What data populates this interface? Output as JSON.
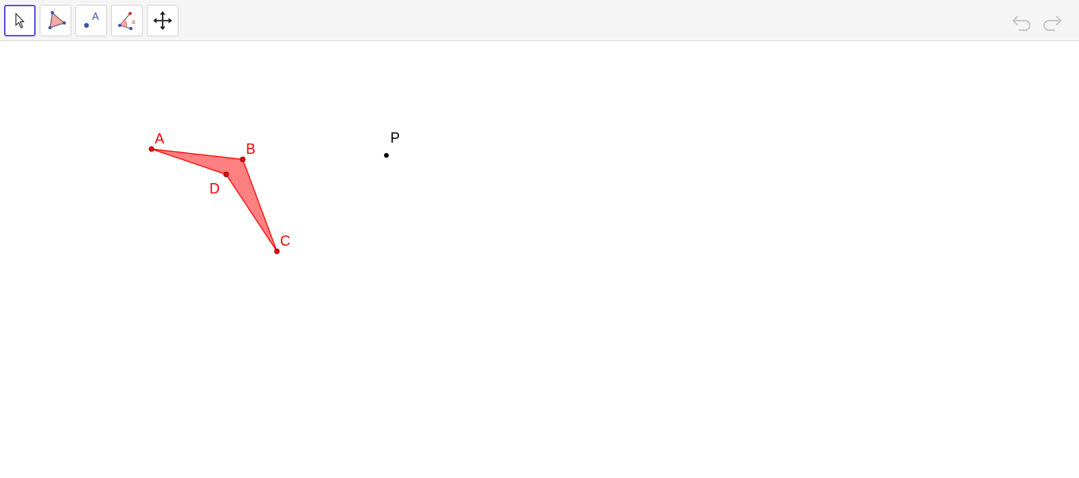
{
  "toolbar": {
    "tools": [
      {
        "icon": "move-arrow-icon",
        "selected": true
      },
      {
        "icon": "polygon-icon",
        "selected": false
      },
      {
        "icon": "point-label-icon",
        "selected": false
      },
      {
        "icon": "angle-icon",
        "selected": false
      },
      {
        "icon": "move-graphics-view-icon",
        "selected": false
      }
    ],
    "undo_icon": "undo-icon",
    "redo_icon": "redo-icon",
    "accent_color": "#6557d2",
    "angle_icon_glyph": "α",
    "point_icon_letter": "A"
  },
  "construction": {
    "polygon_color": "#ff0000",
    "polygon_fill": "#ff8080",
    "points": [
      {
        "name": "A",
        "color": "#ff0000"
      },
      {
        "name": "B",
        "color": "#ff0000"
      },
      {
        "name": "C",
        "color": "#ff0000"
      },
      {
        "name": "D",
        "color": "#ff0000"
      },
      {
        "name": "P",
        "color": "#000000"
      }
    ]
  }
}
